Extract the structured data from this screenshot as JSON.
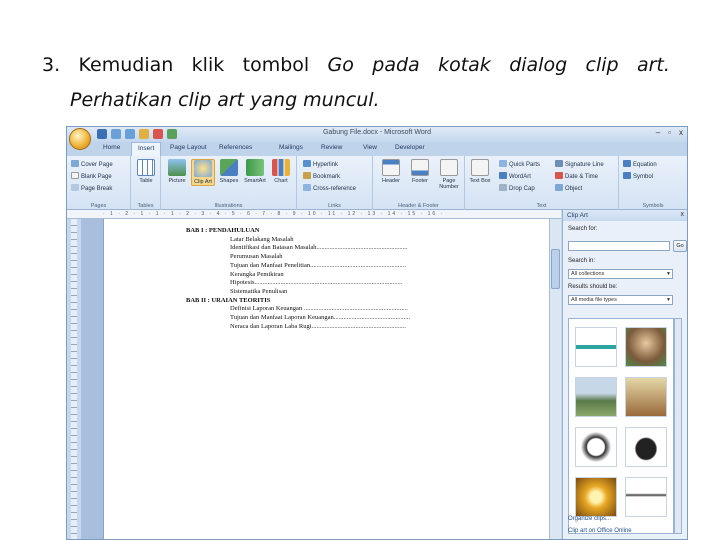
{
  "instruction": {
    "number": "3.",
    "words": [
      "Kemudian",
      "klik",
      "tombol",
      "Go",
      "pada",
      "kotak",
      "dialog",
      "clip",
      "art."
    ],
    "italic_words": [
      "Go",
      "pada",
      "kotak",
      "dialog",
      "clip",
      "art."
    ],
    "line2": "Perhatikan clip art yang muncul."
  },
  "word": {
    "title": "Gabung File.docx - Microsoft Word",
    "window_controls": [
      "–",
      "▫",
      "x"
    ],
    "tabs": [
      "Home",
      "Insert",
      "Page Layout",
      "References",
      "Mailings",
      "Review",
      "View",
      "Developer"
    ],
    "active_tab": "Insert",
    "ribbon": {
      "pages": {
        "label": "Pages",
        "items": [
          "Cover Page",
          "Blank Page",
          "Page Break"
        ]
      },
      "tables": {
        "label": "Tables",
        "items": [
          "Table"
        ]
      },
      "illustrations": {
        "label": "Illustrations",
        "items": [
          "Picture",
          "Clip Art",
          "Shapes",
          "SmartArt",
          "Chart"
        ]
      },
      "links": {
        "label": "Links",
        "items": [
          "Hyperlink",
          "Bookmark",
          "Cross-reference"
        ]
      },
      "header_footer": {
        "label": "Header & Footer",
        "items": [
          "Header",
          "Footer",
          "Page Number"
        ]
      },
      "text": {
        "label": "Text",
        "items": [
          "Text Box",
          "Quick Parts",
          "WordArt",
          "Drop Cap",
          "Signature Line",
          "Date & Time",
          "Object"
        ]
      },
      "symbols": {
        "label": "Symbols",
        "items": [
          "Equation",
          "Symbol"
        ]
      }
    },
    "ruler": "· 1 · 2 · 1 · 1 · 1 · 2 · 3 · 4 · 5 · 6 · 7 · 8 · 9 · 10 · 11 · 12 · 13 · 14 · 15 · 16 ·",
    "document": {
      "lines": [
        {
          "kind": "h",
          "text": "BAB I        : PENDAHULUAN"
        },
        {
          "kind": "sub",
          "text": "Latar Belakang Masalah"
        },
        {
          "kind": "sub",
          "text": "Identifikasi dan Batasan Masalah........................................................"
        },
        {
          "kind": "sub",
          "text": "Perumusan Masalah"
        },
        {
          "kind": "sub",
          "text": "Tujuan dan Manfaat Penelitian..........................................................."
        },
        {
          "kind": "sub",
          "text": "Kerangka Pemikiran"
        },
        {
          "kind": "sub",
          "text": "Hipotesis..........................................................................................."
        },
        {
          "kind": "sub",
          "text": "Sistematika Penulisan"
        },
        {
          "kind": "h",
          "text": "BAB II   : URAIAN TEORITIS"
        },
        {
          "kind": "sub",
          "text": "Definisi Laporan Keuangan ................................................................"
        },
        {
          "kind": "sub",
          "text": "Tujuan dan Manfaat Laporan Keuangan..............................................."
        },
        {
          "kind": "sub",
          "text": "Neraca dan Laporan Laba Rugi.........................................................."
        }
      ]
    },
    "clip_art_pane": {
      "title": "Clip Art",
      "close": "x",
      "search_for_label": "Search for:",
      "search_value": "",
      "go_label": "Go",
      "search_in_label": "Search in:",
      "search_in_value": "All collections",
      "results_label": "Results should be:",
      "results_value": "All media file types",
      "links": [
        "Organize clips...",
        "Clip art on Office Online"
      ]
    }
  }
}
